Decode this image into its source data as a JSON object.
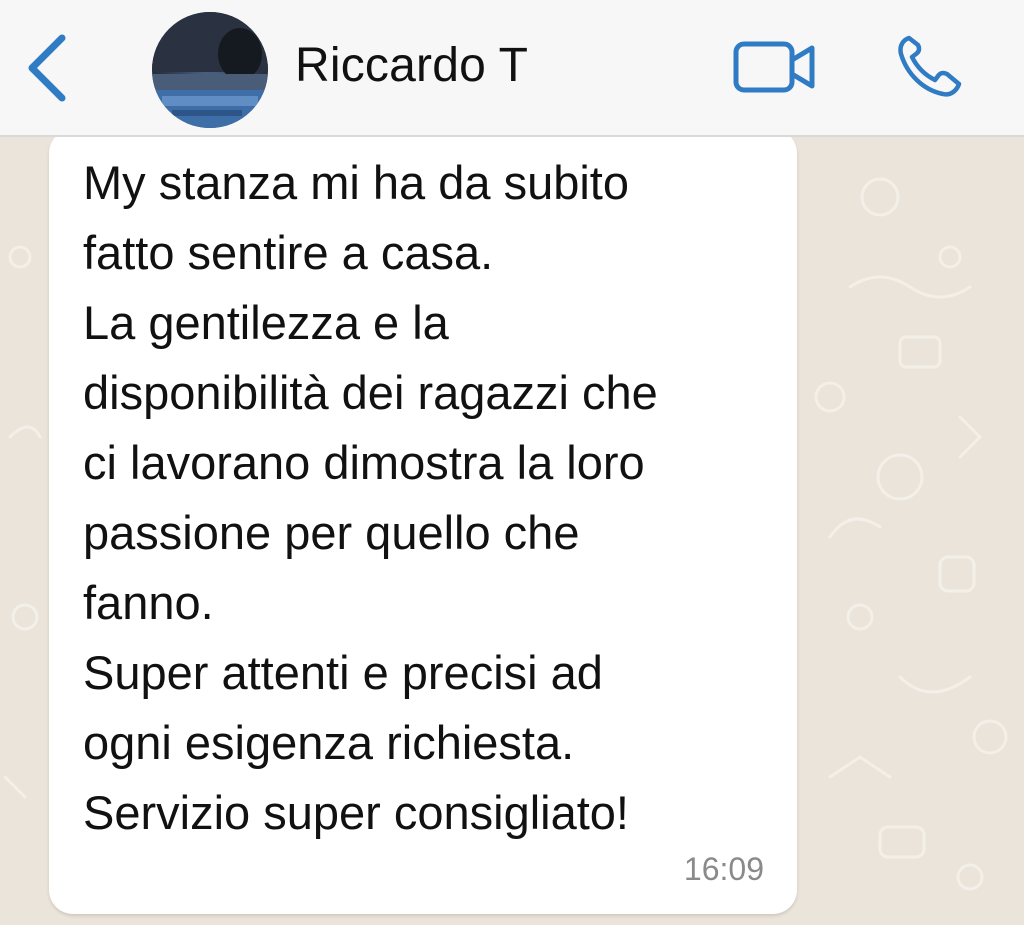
{
  "header": {
    "contact_name": "Riccardo T",
    "back_icon": "chevron-left-icon",
    "video_icon": "video-camera-icon",
    "call_icon": "phone-icon",
    "accent_color": "#2f7bc4"
  },
  "messages": [
    {
      "text": "My stanza mi ha da subito\nfatto sentire a casa.\nLa gentilezza e la\ndisponibilità dei ragazzi che\nci lavorano dimostra la loro\npassione per quello che\nfanno.\nSuper attenti e precisi ad\nogni esigenza richiesta.\nServizio super consigliato!",
      "time": "16:09"
    }
  ],
  "colors": {
    "header_bg": "#f7f7f7",
    "chat_bg": "#ebe4da",
    "bubble_bg": "#ffffff",
    "timestamp": "#8a8a8a"
  }
}
